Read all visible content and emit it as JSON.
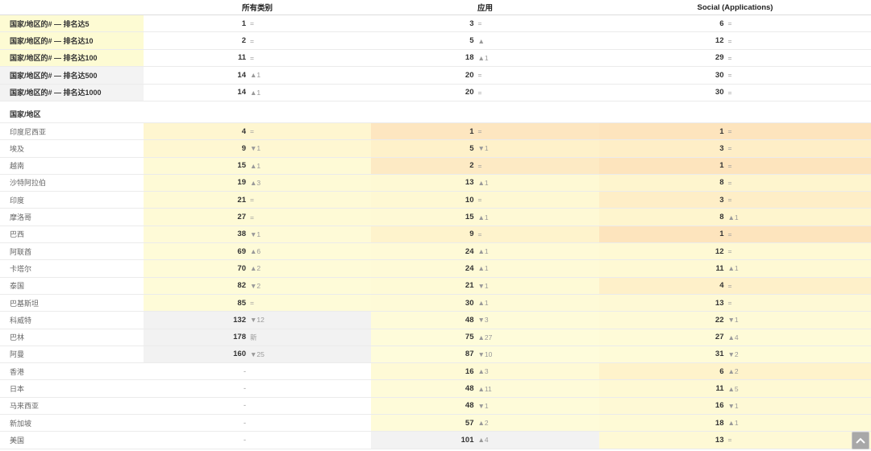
{
  "header": {
    "col_all": "所有类别",
    "col_apps": "应用",
    "col_social": "Social (Applications)"
  },
  "summary_rows": [
    {
      "label": "国家/地区的# — 排名达5",
      "bg": "#fdfbd3",
      "cells": [
        {
          "rank": "1",
          "change": "="
        },
        {
          "rank": "3",
          "change": "="
        },
        {
          "rank": "6",
          "change": "="
        }
      ]
    },
    {
      "label": "国家/地区的# — 排名达10",
      "bg": "#fdfbd3",
      "cells": [
        {
          "rank": "2",
          "change": "="
        },
        {
          "rank": "5",
          "change": "▲"
        },
        {
          "rank": "12",
          "change": "="
        }
      ]
    },
    {
      "label": "国家/地区的# — 排名达100",
      "bg": "#fdfbd3",
      "cells": [
        {
          "rank": "11",
          "change": "="
        },
        {
          "rank": "18",
          "change": "▲1"
        },
        {
          "rank": "29",
          "change": "="
        }
      ]
    },
    {
      "label": "国家/地区的# — 排名达500",
      "bg": "#f3f3f3",
      "cells": [
        {
          "rank": "14",
          "change": "▲1"
        },
        {
          "rank": "20",
          "change": "="
        },
        {
          "rank": "30",
          "change": "="
        }
      ]
    },
    {
      "label": "国家/地区的# — 排名达1000",
      "bg": "#f3f3f3",
      "cells": [
        {
          "rank": "14",
          "change": "▲1"
        },
        {
          "rank": "20",
          "change": "="
        },
        {
          "rank": "30",
          "change": "="
        }
      ]
    }
  ],
  "section_title": "国家/地区",
  "countries": [
    {
      "name": "印度尼西亚",
      "cells": [
        {
          "rank": "4",
          "change": "=",
          "bg": "#fef6d0"
        },
        {
          "rank": "1",
          "change": "=",
          "bg": "#fde6c0"
        },
        {
          "rank": "1",
          "change": "=",
          "bg": "#fde4bd"
        }
      ]
    },
    {
      "name": "埃及",
      "cells": [
        {
          "rank": "9",
          "change": "▼1",
          "bg": "#fef7d2"
        },
        {
          "rank": "5",
          "change": "▼1",
          "bg": "#fef1ca"
        },
        {
          "rank": "3",
          "change": "=",
          "bg": "#feeec7"
        }
      ]
    },
    {
      "name": "越南",
      "cells": [
        {
          "rank": "15",
          "change": "▲1",
          "bg": "#fefad6"
        },
        {
          "rank": "2",
          "change": "=",
          "bg": "#fdeac4"
        },
        {
          "rank": "1",
          "change": "=",
          "bg": "#fde4bd"
        }
      ]
    },
    {
      "name": "沙特阿拉伯",
      "cells": [
        {
          "rank": "19",
          "change": "▲3",
          "bg": "#fefad6"
        },
        {
          "rank": "13",
          "change": "▲1",
          "bg": "#fef9d4"
        },
        {
          "rank": "8",
          "change": "=",
          "bg": "#fef5ce"
        }
      ]
    },
    {
      "name": "印度",
      "cells": [
        {
          "rank": "21",
          "change": "=",
          "bg": "#fefad6"
        },
        {
          "rank": "10",
          "change": "=",
          "bg": "#fef8d3"
        },
        {
          "rank": "3",
          "change": "=",
          "bg": "#feeec7"
        }
      ]
    },
    {
      "name": "摩洛哥",
      "cells": [
        {
          "rank": "27",
          "change": "=",
          "bg": "#fefad6"
        },
        {
          "rank": "15",
          "change": "▲1",
          "bg": "#fef9d5"
        },
        {
          "rank": "8",
          "change": "▲1",
          "bg": "#fef5ce"
        }
      ]
    },
    {
      "name": "巴西",
      "cells": [
        {
          "rank": "38",
          "change": "▼1",
          "bg": "#fefad7"
        },
        {
          "rank": "9",
          "change": "=",
          "bg": "#fef3cc"
        },
        {
          "rank": "1",
          "change": "=",
          "bg": "#fde4bd"
        }
      ]
    },
    {
      "name": "阿联酋",
      "cells": [
        {
          "rank": "69",
          "change": "▲6",
          "bg": "#fefbd8"
        },
        {
          "rank": "24",
          "change": "▲1",
          "bg": "#fefad7"
        },
        {
          "rank": "12",
          "change": "=",
          "bg": "#fef9d4"
        }
      ]
    },
    {
      "name": "卡塔尔",
      "cells": [
        {
          "rank": "70",
          "change": "▲2",
          "bg": "#fefbd8"
        },
        {
          "rank": "24",
          "change": "▲1",
          "bg": "#fefad7"
        },
        {
          "rank": "11",
          "change": "▲1",
          "bg": "#fef9d4"
        }
      ]
    },
    {
      "name": "泰国",
      "cells": [
        {
          "rank": "82",
          "change": "▼2",
          "bg": "#fefbd8"
        },
        {
          "rank": "21",
          "change": "▼1",
          "bg": "#fefad6"
        },
        {
          "rank": "4",
          "change": "=",
          "bg": "#fef0c9"
        }
      ]
    },
    {
      "name": "巴基斯坦",
      "cells": [
        {
          "rank": "85",
          "change": "=",
          "bg": "#fefbd8"
        },
        {
          "rank": "30",
          "change": "▲1",
          "bg": "#fefad7"
        },
        {
          "rank": "13",
          "change": "=",
          "bg": "#fef9d5"
        }
      ]
    },
    {
      "name": "科威特",
      "cells": [
        {
          "rank": "132",
          "change": "▼12",
          "bg": "#f2f2f2"
        },
        {
          "rank": "48",
          "change": "▼3",
          "bg": "#fefbd9"
        },
        {
          "rank": "22",
          "change": "▼1",
          "bg": "#fefad7"
        }
      ]
    },
    {
      "name": "巴林",
      "cells": [
        {
          "rank": "178",
          "change": "新",
          "bg": "#f2f2f2"
        },
        {
          "rank": "75",
          "change": "▲27",
          "bg": "#fefcda"
        },
        {
          "rank": "27",
          "change": "▲4",
          "bg": "#fefbd8"
        }
      ]
    },
    {
      "name": "阿曼",
      "cells": [
        {
          "rank": "160",
          "change": "▼25",
          "bg": "#f2f2f2"
        },
        {
          "rank": "87",
          "change": "▼10",
          "bg": "#fefcdb"
        },
        {
          "rank": "31",
          "change": "▼2",
          "bg": "#fefbd8"
        }
      ]
    },
    {
      "name": "香港",
      "cells": [
        {
          "rank": "-",
          "bg": "#ffffff"
        },
        {
          "rank": "16",
          "change": "▲3",
          "bg": "#fefad6"
        },
        {
          "rank": "6",
          "change": "▲2",
          "bg": "#fef3cb"
        }
      ]
    },
    {
      "name": "日本",
      "cells": [
        {
          "rank": "-",
          "bg": "#ffffff"
        },
        {
          "rank": "48",
          "change": "▲11",
          "bg": "#fefbd9"
        },
        {
          "rank": "11",
          "change": "▲5",
          "bg": "#fef9d4"
        }
      ]
    },
    {
      "name": "马来西亚",
      "cells": [
        {
          "rank": "-",
          "bg": "#ffffff"
        },
        {
          "rank": "48",
          "change": "▼1",
          "bg": "#fefbd9"
        },
        {
          "rank": "16",
          "change": "▼1",
          "bg": "#fef9d5"
        }
      ]
    },
    {
      "name": "新加坡",
      "cells": [
        {
          "rank": "-",
          "bg": "#ffffff"
        },
        {
          "rank": "57",
          "change": "▲2",
          "bg": "#fefbd9"
        },
        {
          "rank": "18",
          "change": "▲1",
          "bg": "#fefad6"
        }
      ]
    },
    {
      "name": "美国",
      "cells": [
        {
          "rank": "-",
          "bg": "#ffffff"
        },
        {
          "rank": "101",
          "change": "▲4",
          "bg": "#f2f2f2"
        },
        {
          "rank": "13",
          "change": "=",
          "bg": "#fef9d5"
        }
      ]
    }
  ],
  "scroll_top": {
    "icon": "chevron-up-icon"
  },
  "colors": {
    "change_text": "#999999",
    "label_text": "#666666",
    "strong_text": "#333333",
    "row_border": "#ebebeb",
    "scroll_button": "#a8a8a8"
  }
}
